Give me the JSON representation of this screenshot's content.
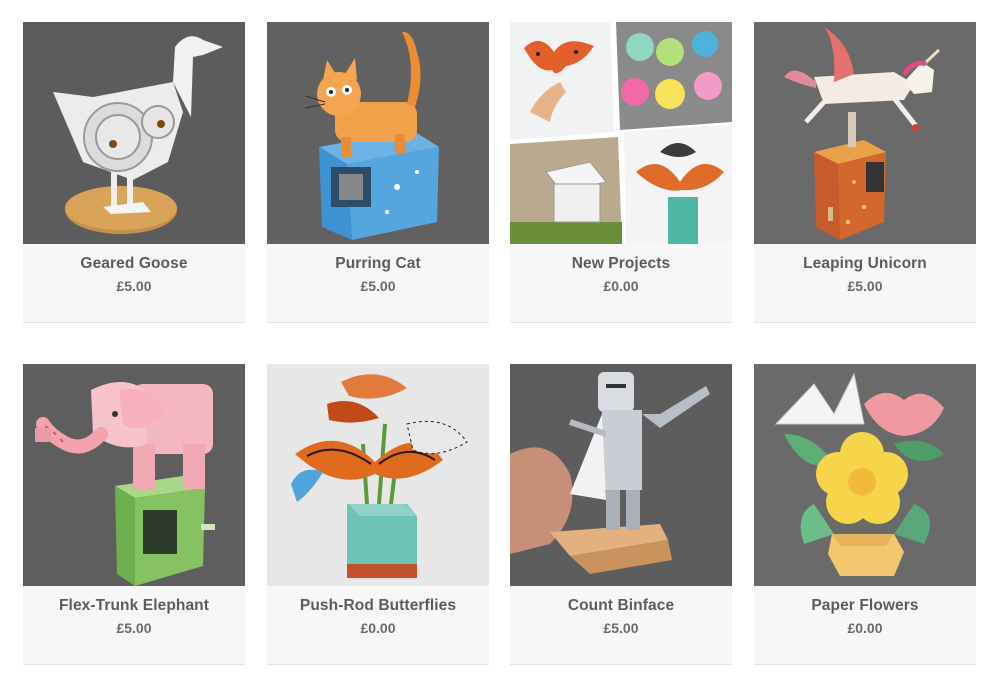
{
  "products": [
    {
      "name": "Geared Goose",
      "price": "£5.00",
      "image": "geared-goose-image"
    },
    {
      "name": "Purring Cat",
      "price": "£5.00",
      "image": "purring-cat-image"
    },
    {
      "name": "New Projects",
      "price": "£0.00",
      "image": "new-projects-collage-image"
    },
    {
      "name": "Leaping Unicorn",
      "price": "£5.00",
      "image": "leaping-unicorn-image"
    },
    {
      "name": "Flex-Trunk Elephant",
      "price": "£5.00",
      "image": "flex-trunk-elephant-image"
    },
    {
      "name": "Push-Rod Butterflies",
      "price": "£0.00",
      "image": "push-rod-butterflies-image"
    },
    {
      "name": "Count Binface",
      "price": "£5.00",
      "image": "count-binface-image"
    },
    {
      "name": "Paper Flowers",
      "price": "£0.00",
      "image": "paper-flowers-image"
    }
  ]
}
